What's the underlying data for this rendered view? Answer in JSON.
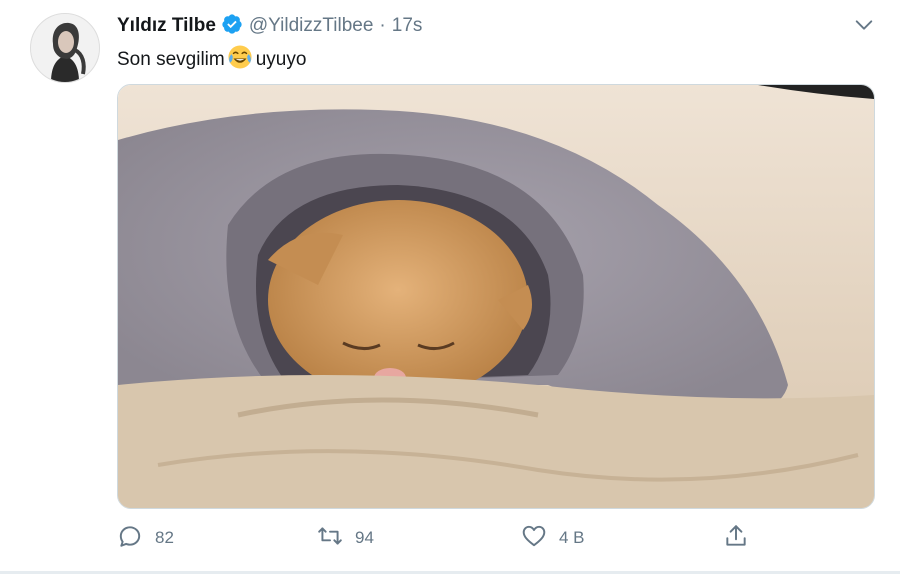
{
  "tweet": {
    "display_name": "Yıldız Tilbe",
    "handle": "@YildizzTilbee",
    "separator": "·",
    "time": "17s",
    "text_before": "Son sevgilim",
    "text_after": "uyuyo"
  },
  "actions": {
    "reply_count": "82",
    "retweet_count": "94",
    "like_count": "4 B"
  },
  "icons": {
    "verified": "verified-badge-icon",
    "caret": "chevron-down-icon",
    "emoji": "face-with-tears-of-joy-emoji",
    "reply": "reply-icon",
    "retweet": "retweet-icon",
    "like": "heart-icon",
    "share": "share-icon"
  },
  "colors": {
    "name": "#14171a",
    "meta": "#657786",
    "verified": "#1da1f2",
    "divider": "#e6ecf0"
  }
}
